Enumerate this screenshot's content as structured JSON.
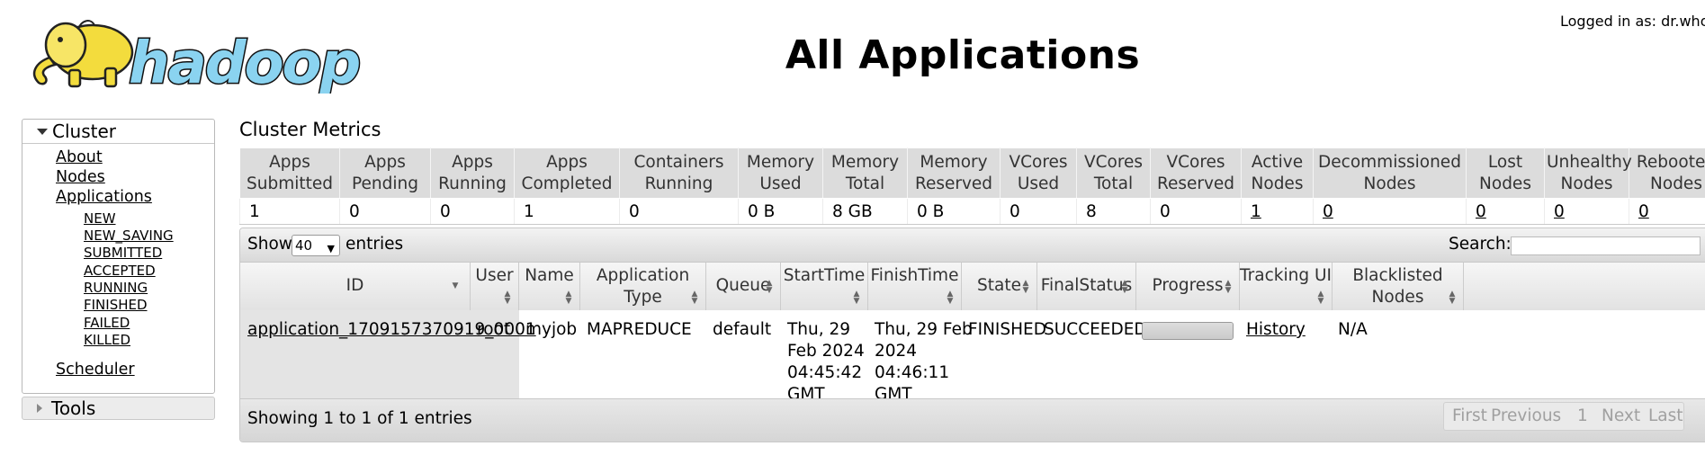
{
  "header": {
    "logo_text": "hadoop",
    "title": "All Applications",
    "logged_in": "Logged in as: dr.who"
  },
  "sidebar": {
    "cluster_label": "Cluster",
    "items": [
      {
        "label": "About"
      },
      {
        "label": "Nodes"
      },
      {
        "label": "Applications"
      }
    ],
    "app_states": [
      "NEW",
      "NEW_SAVING",
      "SUBMITTED",
      "ACCEPTED",
      "RUNNING",
      "FINISHED",
      "FAILED",
      "KILLED"
    ],
    "scheduler_label": "Scheduler",
    "tools_label": "Tools"
  },
  "metrics": {
    "title": "Cluster Metrics",
    "headers": [
      [
        "Apps",
        "Submitted"
      ],
      [
        "Apps",
        "Pending"
      ],
      [
        "Apps",
        "Running"
      ],
      [
        "Apps",
        "Completed"
      ],
      [
        "Containers",
        "Running"
      ],
      [
        "Memory",
        "Used"
      ],
      [
        "Memory",
        "Total"
      ],
      [
        "Memory",
        "Reserved"
      ],
      [
        "VCores",
        "Used"
      ],
      [
        "VCores",
        "Total"
      ],
      [
        "VCores",
        "Reserved"
      ],
      [
        "Active",
        "Nodes"
      ],
      [
        "Decommissioned",
        "Nodes"
      ],
      [
        "Lost",
        "Nodes"
      ],
      [
        "Unhealthy",
        "Nodes"
      ],
      [
        "Rebooted",
        "Nodes"
      ]
    ],
    "values": [
      "1",
      "0",
      "0",
      "1",
      "0",
      "0 B",
      "8 GB",
      "0 B",
      "0",
      "8",
      "0",
      "1",
      "0",
      "0",
      "0",
      "0"
    ]
  },
  "apps_table": {
    "show_label": "Show",
    "page_length": "40",
    "entries_label": "entries",
    "search_label": "Search:",
    "search_value": "",
    "columns": [
      [
        "ID"
      ],
      [
        "User"
      ],
      [
        "Name"
      ],
      [
        "Application Type"
      ],
      [
        "Queue"
      ],
      [
        "StartTime"
      ],
      [
        "FinishTime"
      ],
      [
        "State"
      ],
      [
        "FinalStatus"
      ],
      [
        "Progress"
      ],
      [
        "Tracking UI"
      ],
      [
        "Blacklisted",
        "Nodes"
      ]
    ],
    "rows": [
      {
        "id": "application_1709157370919_0001",
        "user": "root",
        "name": "myjob",
        "type": "MAPREDUCE",
        "queue": "default",
        "start": [
          "Thu, 29",
          "Feb 2024",
          "04:45:42",
          "GMT"
        ],
        "finish": [
          "Thu, 29 Feb",
          "2024",
          "04:46:11",
          "GMT"
        ],
        "state": "FINISHED",
        "final_status": "SUCCEEDED",
        "progress": 1.0,
        "tracking": "History",
        "blacklisted": "N/A"
      }
    ],
    "info": "Showing 1 to 1 of 1 entries",
    "pagination": {
      "first": "First",
      "previous": "Previous",
      "page": "1",
      "next": "Next",
      "last": "Last"
    }
  },
  "colors": {
    "logo_yellow": "#f5e04a",
    "logo_blue": "#7fd0ef",
    "header_gray": "#dcdcdc"
  }
}
